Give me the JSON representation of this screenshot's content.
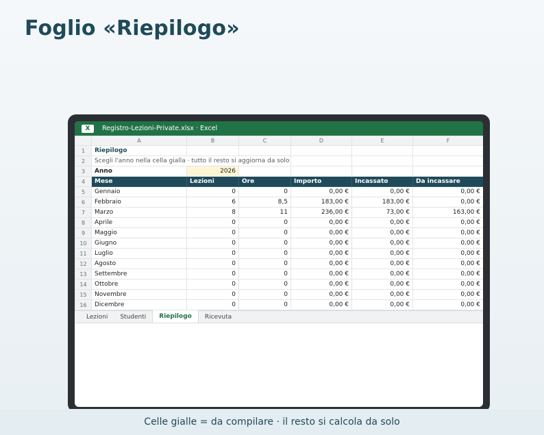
{
  "page": {
    "title": "Foglio «Riepilogo»",
    "footer": "Celle gialle = da compilare · il resto si calcola da solo"
  },
  "window": {
    "app_icon": "X",
    "title": "Registro-Lezioni-Private.xlsx · Excel",
    "accent_color": "#217346"
  },
  "columns": [
    "A",
    "B",
    "C",
    "D",
    "E",
    "F"
  ],
  "rows": {
    "r1": {
      "num": "1",
      "a": "Riepilogo"
    },
    "r2": {
      "num": "2",
      "a": "Scegli l'anno nella cella gialla · tutto il resto si aggiorna da solo"
    },
    "r3": {
      "num": "3",
      "a": "Anno",
      "b": "2026"
    },
    "r4": {
      "num": "4",
      "headers": [
        "Mese",
        "Lezioni",
        "Ore",
        "Importo",
        "Incassato",
        "Da incassare"
      ]
    }
  },
  "months": [
    {
      "num": "5",
      "mese": "Gennaio",
      "lezioni": "0",
      "ore": "0",
      "importo": "0,00 €",
      "incassato": "0,00 €",
      "da_incassare": "0,00 €"
    },
    {
      "num": "6",
      "mese": "Febbraio",
      "lezioni": "6",
      "ore": "8,5",
      "importo": "183,00 €",
      "incassato": "183,00 €",
      "da_incassare": "0,00 €"
    },
    {
      "num": "7",
      "mese": "Marzo",
      "lezioni": "8",
      "ore": "11",
      "importo": "236,00 €",
      "incassato": "73,00 €",
      "da_incassare": "163,00 €"
    },
    {
      "num": "8",
      "mese": "Aprile",
      "lezioni": "0",
      "ore": "0",
      "importo": "0,00 €",
      "incassato": "0,00 €",
      "da_incassare": "0,00 €"
    },
    {
      "num": "9",
      "mese": "Maggio",
      "lezioni": "0",
      "ore": "0",
      "importo": "0,00 €",
      "incassato": "0,00 €",
      "da_incassare": "0,00 €"
    },
    {
      "num": "10",
      "mese": "Giugno",
      "lezioni": "0",
      "ore": "0",
      "importo": "0,00 €",
      "incassato": "0,00 €",
      "da_incassare": "0,00 €"
    },
    {
      "num": "11",
      "mese": "Luglio",
      "lezioni": "0",
      "ore": "0",
      "importo": "0,00 €",
      "incassato": "0,00 €",
      "da_incassare": "0,00 €"
    },
    {
      "num": "12",
      "mese": "Agosto",
      "lezioni": "0",
      "ore": "0",
      "importo": "0,00 €",
      "incassato": "0,00 €",
      "da_incassare": "0,00 €"
    },
    {
      "num": "13",
      "mese": "Settembre",
      "lezioni": "0",
      "ore": "0",
      "importo": "0,00 €",
      "incassato": "0,00 €",
      "da_incassare": "0,00 €"
    },
    {
      "num": "14",
      "mese": "Ottobre",
      "lezioni": "0",
      "ore": "0",
      "importo": "0,00 €",
      "incassato": "0,00 €",
      "da_incassare": "0,00 €"
    },
    {
      "num": "15",
      "mese": "Novembre",
      "lezioni": "0",
      "ore": "0",
      "importo": "0,00 €",
      "incassato": "0,00 €",
      "da_incassare": "0,00 €"
    },
    {
      "num": "16",
      "mese": "Dicembre",
      "lezioni": "0",
      "ore": "0",
      "importo": "0,00 €",
      "incassato": "0,00 €",
      "da_incassare": "0,00 €"
    }
  ],
  "sheet_tabs": [
    {
      "label": "Lezioni",
      "active": false
    },
    {
      "label": "Studenti",
      "active": false
    },
    {
      "label": "Riepilogo",
      "active": true
    },
    {
      "label": "Ricevuta",
      "active": false
    }
  ],
  "colors": {
    "header_fill": "#1f4a5a",
    "input_fill": "#fff6d6",
    "title_text": "#1f4a5a"
  }
}
